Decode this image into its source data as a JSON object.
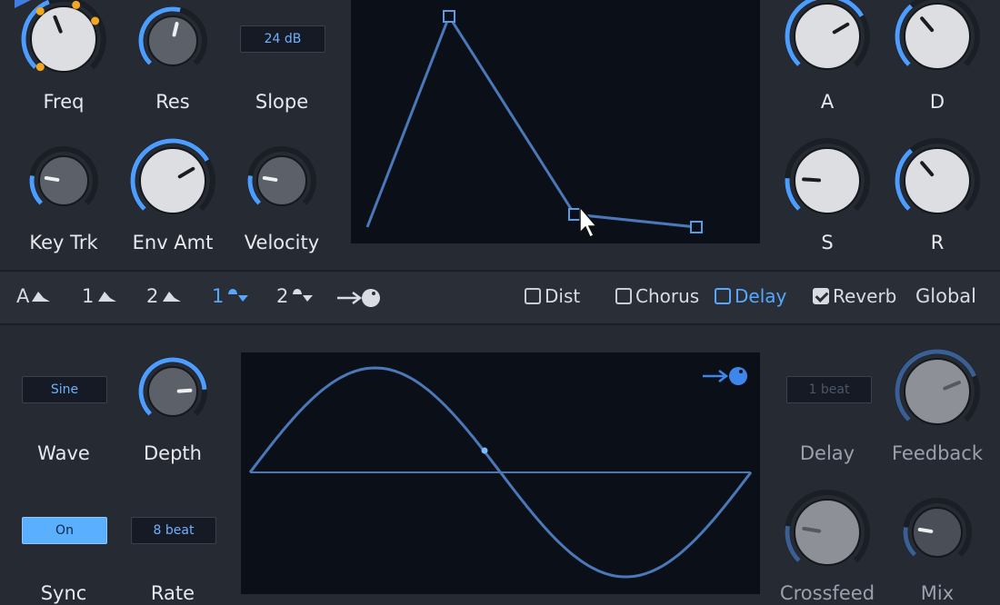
{
  "filter": {
    "freq": {
      "label": "Freq",
      "value": 0.42
    },
    "res": {
      "label": "Res",
      "value": 0.55
    },
    "slope": {
      "label": "Slope",
      "value": "24 dB"
    },
    "key_trk": {
      "label": "Key Trk",
      "value": 0.2
    },
    "env_amt": {
      "label": "Env Amt",
      "value": 0.72
    },
    "velocity": {
      "label": "Velocity",
      "value": 0.2
    }
  },
  "envelope": {
    "a": {
      "label": "A",
      "value": 0.72
    },
    "d": {
      "label": "D",
      "value": 0.35
    },
    "s": {
      "label": "S",
      "value": 0.18
    },
    "r": {
      "label": "R",
      "value": 0.35
    }
  },
  "tabs": [
    {
      "label": "A",
      "icon": "envelope-shape-icon",
      "active": false
    },
    {
      "label": "1",
      "icon": "envelope-shape-icon",
      "active": false
    },
    {
      "label": "2",
      "icon": "envelope-shape-icon",
      "active": false
    },
    {
      "label": "1",
      "icon": "lfo-shape-icon",
      "active": true
    },
    {
      "label": "2",
      "icon": "lfo-shape-icon",
      "active": false
    },
    {
      "label": "",
      "icon": "modulation-target-icon",
      "active": false
    }
  ],
  "fx_tabs": [
    {
      "label": "Dist",
      "checked": false,
      "active": false
    },
    {
      "label": "Chorus",
      "checked": false,
      "active": false
    },
    {
      "label": "Delay",
      "checked": false,
      "active": true
    },
    {
      "label": "Reverb",
      "checked": true,
      "active": false
    }
  ],
  "global_label": "Global",
  "lfo": {
    "wave": {
      "label": "Wave",
      "value": "Sine"
    },
    "depth": {
      "label": "Depth",
      "value": 0.82
    },
    "sync": {
      "label": "Sync",
      "value": "On"
    },
    "rate": {
      "label": "Rate",
      "value": "8 beat"
    }
  },
  "delay": {
    "delay": {
      "label": "Delay",
      "value": "1 beat"
    },
    "feedback": {
      "label": "Feedback",
      "value": 0.75
    },
    "crossfeed": {
      "label": "Crossfeed",
      "value": 0.2
    },
    "mix": {
      "label": "Mix",
      "value": 0.2
    }
  },
  "colors": {
    "accent": "#4d9dff",
    "amber": "#f3a623",
    "panel": "#0b0f18",
    "curve": "#4a78b8"
  }
}
